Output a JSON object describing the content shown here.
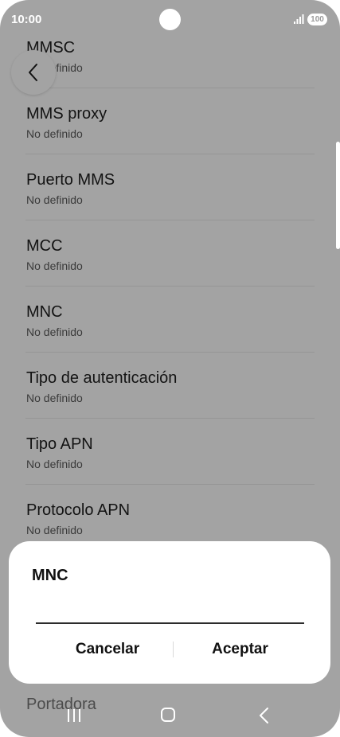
{
  "status_bar": {
    "time": "10:00",
    "battery": "100",
    "icons": [
      "camera-cutout",
      "signal-icon",
      "battery-icon"
    ]
  },
  "navigation": {
    "back_icon": "chevron-left-icon"
  },
  "apn_settings": {
    "items": [
      {
        "title": "MMSC",
        "value": "No definido"
      },
      {
        "title": "MMS proxy",
        "value": "No definido"
      },
      {
        "title": "Puerto MMS",
        "value": "No definido"
      },
      {
        "title": "MCC",
        "value": "No definido"
      },
      {
        "title": "MNC",
        "value": "No definido"
      },
      {
        "title": "Tipo de autenticación",
        "value": "No definido"
      },
      {
        "title": "Tipo APN",
        "value": "No definido"
      },
      {
        "title": "Protocolo APN",
        "value": "No definido"
      }
    ],
    "partially_visible_item": "Portadora"
  },
  "dialog": {
    "title": "MNC",
    "input_value": "",
    "cancel_label": "Cancelar",
    "accept_label": "Aceptar"
  },
  "system_nav": {
    "icons": [
      "recents-icon",
      "home-icon",
      "back-icon"
    ]
  },
  "colors": {
    "scrim": "#a3a3a3",
    "dialog_bg": "#ffffff",
    "text_primary": "#111111"
  }
}
